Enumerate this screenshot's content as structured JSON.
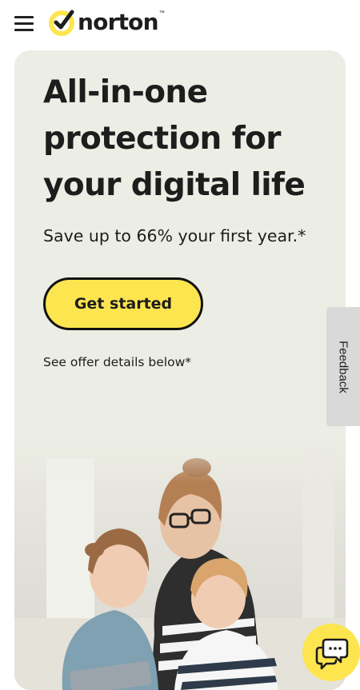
{
  "header": {
    "menu_icon": "hamburger-menu-icon",
    "logo_text": "norton",
    "logo_tm": "™"
  },
  "hero": {
    "title": "All-in-one protection for your digital life",
    "subtitle": "Save up to 66% your first year.*",
    "cta_label": "Get started",
    "offer_note": "See offer details below*"
  },
  "feedback": {
    "label": "Feedback"
  },
  "chat": {
    "icon": "chat-bubbles-icon"
  },
  "colors": {
    "brand_yellow": "#fde550",
    "hero_background": "#ecede4",
    "text": "#1d1d1d",
    "feedback_tab": "#d9d9d9"
  }
}
